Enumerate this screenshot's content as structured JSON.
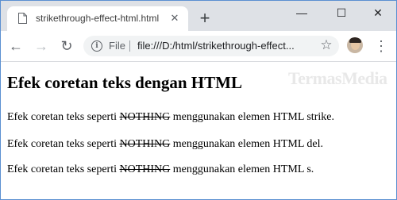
{
  "tab": {
    "title": "strikethrough-effect-html.html",
    "close_glyph": "✕"
  },
  "new_tab_glyph": "+",
  "window_controls": {
    "minimize": "—",
    "maximize": "☐",
    "close": "✕"
  },
  "toolbar": {
    "back_glyph": "←",
    "forward_glyph": "→",
    "reload_glyph": "↻",
    "info_glyph": "i",
    "scheme_label": "File",
    "url": "file:///D:/html/strikethrough-effect...",
    "star_glyph": "☆",
    "menu_glyph": "⋮"
  },
  "icons": [
    "document-icon",
    "close-icon",
    "plus-icon",
    "minimize-icon",
    "maximize-icon",
    "close-window-icon",
    "back-arrow-icon",
    "forward-arrow-icon",
    "reload-icon",
    "info-icon",
    "star-icon",
    "avatar",
    "menu-icon"
  ],
  "page": {
    "watermark": "TermasMedia",
    "heading": "Efek coretan teks dengan HTML",
    "paragraphs": [
      {
        "before": "Efek coretan teks seperti ",
        "struck": "NOTHING",
        "after": " menggunakan elemen HTML strike."
      },
      {
        "before": "Efek coretan teks seperti ",
        "struck": "NOTHING",
        "after": " menggunakan elemen HTML del."
      },
      {
        "before": "Efek coretan teks seperti ",
        "struck": "NOTHING",
        "after": " menggunakan elemen HTML s."
      }
    ]
  },
  "colors": {
    "window_border": "#5b8fd1",
    "tabstrip_bg": "#dee1e6",
    "omnibox_bg": "#f1f3f4"
  }
}
